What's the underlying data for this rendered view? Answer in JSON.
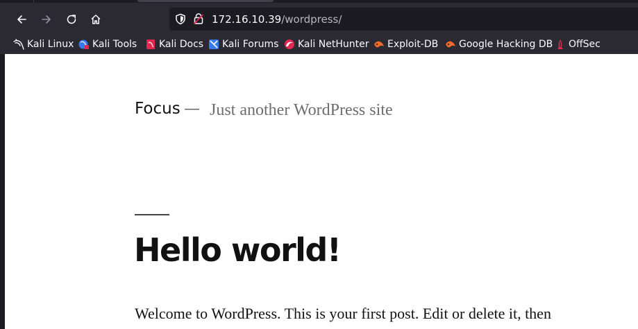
{
  "browser": {
    "address": {
      "host": "172.16.10.39",
      "path": "/wordpress/"
    },
    "nav_icons": [
      "back-arrow-icon",
      "forward-arrow-icon",
      "reload-icon",
      "home-icon"
    ],
    "bookmarks": [
      {
        "label": "Kali Linux",
        "icon": "kali-dragon-icon"
      },
      {
        "label": "Kali Tools",
        "icon": "kali-tools-icon"
      },
      {
        "label": "Kali Docs",
        "icon": "kali-docs-icon"
      },
      {
        "label": "Kali Forums",
        "icon": "kali-forums-icon"
      },
      {
        "label": "Kali NetHunter",
        "icon": "nethunter-icon"
      },
      {
        "label": "Exploit-DB",
        "icon": "exploit-db-icon"
      },
      {
        "label": "Google Hacking DB",
        "icon": "ghdb-icon"
      },
      {
        "label": "OffSec",
        "icon": "offsec-icon"
      }
    ],
    "colors": {
      "toolbar": "#2b2a33",
      "urlbar": "#1c1b22",
      "accent": "#367bf0"
    }
  },
  "site": {
    "title": "Focus",
    "dash": "—",
    "description": "Just another WordPress site"
  },
  "post": {
    "title": "Hello world!",
    "excerpt": "Welcome to WordPress. This is your first post. Edit or delete it, then"
  }
}
